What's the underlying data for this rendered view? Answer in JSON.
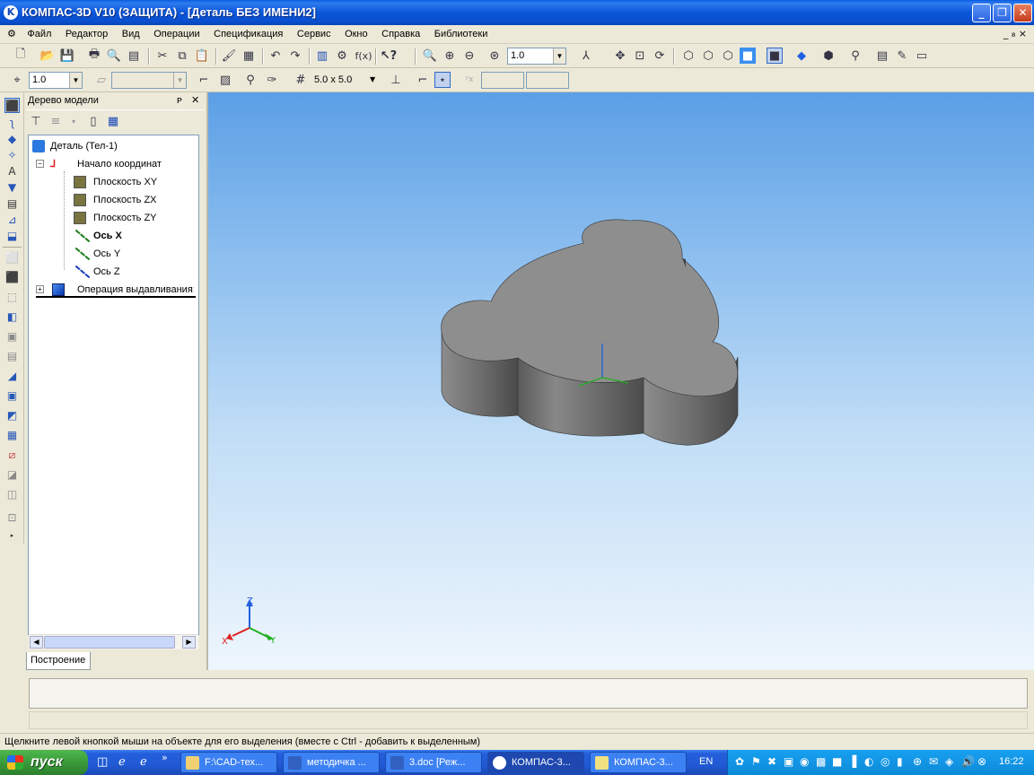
{
  "window": {
    "title": "КОМПАС-3D V10 (ЗАЩИТА) - [Деталь БЕЗ ИМЕНИ2]",
    "minimize": "_",
    "restore": "❐",
    "close": "✕"
  },
  "menu": {
    "items": [
      "Файл",
      "Редактор",
      "Вид",
      "Операции",
      "Спецификация",
      "Сервис",
      "Окно",
      "Справка",
      "Библиотеки"
    ],
    "doc_controls": "_ ₈ ×"
  },
  "toolbar1": {
    "zoom_value": "1.0",
    "fx_label": "f(x)"
  },
  "toolbar2": {
    "scale_value": "1.0",
    "style_value": "",
    "grid_value": "5.0 x 5.0",
    "coord_x": "",
    "coord_y": ""
  },
  "panel": {
    "title": "Дерево модели",
    "pin": "ᴘ",
    "close": "✕",
    "tab": "Построение",
    "tree": {
      "root": "Деталь (Тел-1)",
      "origin": "Начало координат",
      "items": [
        "Плоскость XY",
        "Плоскость ZX",
        "Плоскость ZY",
        "Ось X",
        "Ось Y",
        "Ось Z"
      ],
      "operation": "Операция выдавливания:1"
    }
  },
  "viewport": {
    "axis_labels": {
      "x": "X",
      "y": "Y",
      "z": "Z"
    }
  },
  "status": {
    "text": "Щелкните левой кнопкой мыши на объекте для его выделения (вместе с Ctrl - добавить к выделенным)"
  },
  "taskbar": {
    "start": "пуск",
    "tasks": [
      "F:\\CAD-тех...",
      "методичка ...",
      "3.doc [Реж...",
      "КОМПАС-3...",
      "КОМПАС-3..."
    ],
    "lang": "EN",
    "clock": "16:22"
  },
  "colors": {
    "title_blue": "#0a5ddf",
    "part_top": "#8e8e8e",
    "part_side": "#6e6e6e",
    "axis_x": "#e02020",
    "axis_y": "#20b020",
    "axis_z": "#2060e0"
  }
}
